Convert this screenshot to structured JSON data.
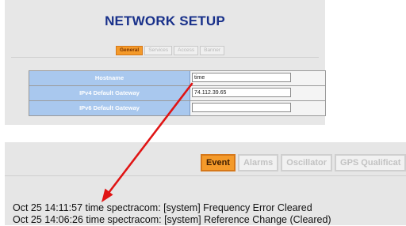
{
  "network_setup": {
    "title": "NETWORK SETUP",
    "tabs": [
      {
        "label": "General",
        "active": true
      },
      {
        "label": "Services",
        "active": false
      },
      {
        "label": "Access",
        "active": false
      },
      {
        "label": "Banner",
        "active": false
      }
    ],
    "fields": [
      {
        "label": "Hostname",
        "value": "time"
      },
      {
        "label": "IPv4 Default Gateway",
        "value": "74.112.39.65"
      },
      {
        "label": "IPv6 Default Gateway",
        "value": ""
      }
    ]
  },
  "event_log": {
    "tabs": [
      {
        "label": "Event",
        "active": true
      },
      {
        "label": "Alarms",
        "active": false
      },
      {
        "label": "Oscillator",
        "active": false
      },
      {
        "label": "GPS Qualificat",
        "active": false
      }
    ],
    "lines": [
      "Oct 25 14:11:57 time spectracom: [system] Frequency Error Cleared",
      "Oct 25 14:06:26 time spectracom: [system] Reference Change (Cleared)"
    ]
  },
  "colors": {
    "title": "#18308a",
    "active_tab": "#f49a2a",
    "label_cell": "#a9c8ee",
    "arrow": "#e01414"
  },
  "annotation": {
    "type": "arrow",
    "from": "hostname-field",
    "to": "log-hostname"
  }
}
